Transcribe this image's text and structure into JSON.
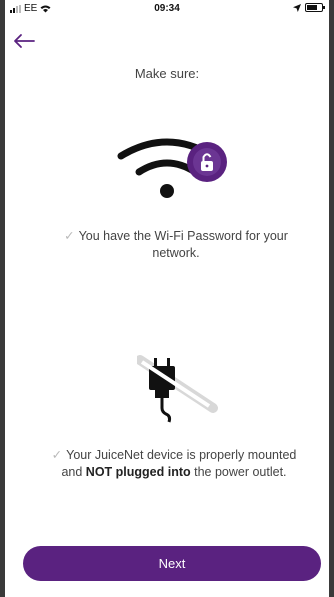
{
  "status_bar": {
    "carrier": "EE",
    "time": "09:34"
  },
  "header": {
    "back_icon": "arrow-left-icon"
  },
  "content": {
    "heading": "Make sure:",
    "items": [
      {
        "icon": "wifi-lock-icon",
        "text": "You have the Wi-Fi Password for your network."
      },
      {
        "icon": "unplugged-icon",
        "text_before": "Your JuiceNet device is properly mounted and ",
        "text_bold": "NOT plugged into",
        "text_after": " the power outlet."
      }
    ]
  },
  "footer": {
    "next_label": "Next"
  },
  "colors": {
    "accent": "#5a2280",
    "check": "#b9b9b9",
    "text": "#444444"
  }
}
